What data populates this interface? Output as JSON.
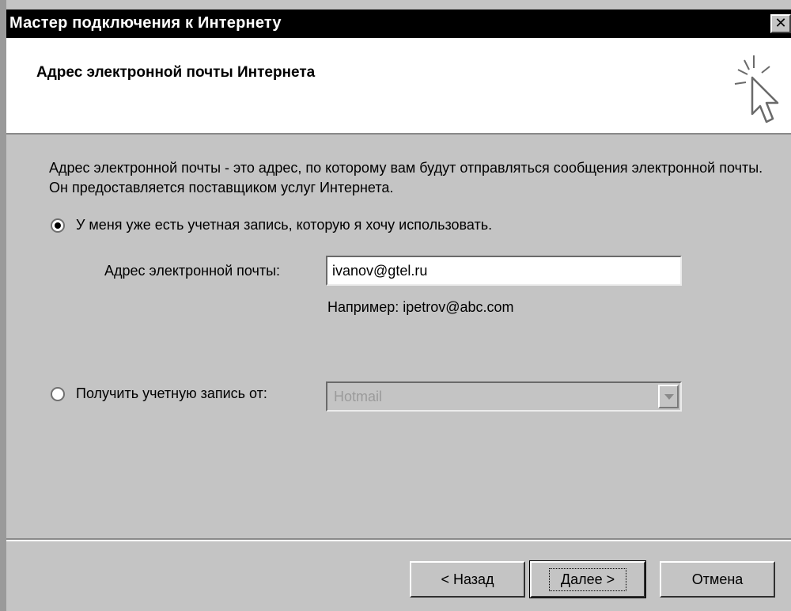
{
  "window": {
    "title": "Мастер подключения к Интернету",
    "close_glyph": "✕"
  },
  "header": {
    "title": "Адрес электронной почты Интернета",
    "icon": "wizard-cursor-icon"
  },
  "body": {
    "description": "Адрес электронной почты - это адрес, по которому вам будут отправляться сообщения электронной почты. Он предоставляется поставщиком услуг Интернета.",
    "option_existing": {
      "label": "У меня уже есть учетная запись, которую я хочу использовать.",
      "selected": true
    },
    "email": {
      "label": "Адрес электронной почты:",
      "value": "ivanov@gtel.ru",
      "example": "Например: ipetrov@abc.com"
    },
    "option_get": {
      "label": "Получить учетную запись от:",
      "selected": false
    },
    "provider": {
      "value": "Hotmail",
      "disabled": true
    }
  },
  "footer": {
    "back_label": "< Назад",
    "next_label": "Далее >",
    "cancel_label": "Отмена"
  },
  "colors": {
    "dialog_bg": "#c4c4c4",
    "title_bar": "#000000",
    "header_bg": "#ffffff",
    "disabled_text": "#9a9a9a"
  }
}
